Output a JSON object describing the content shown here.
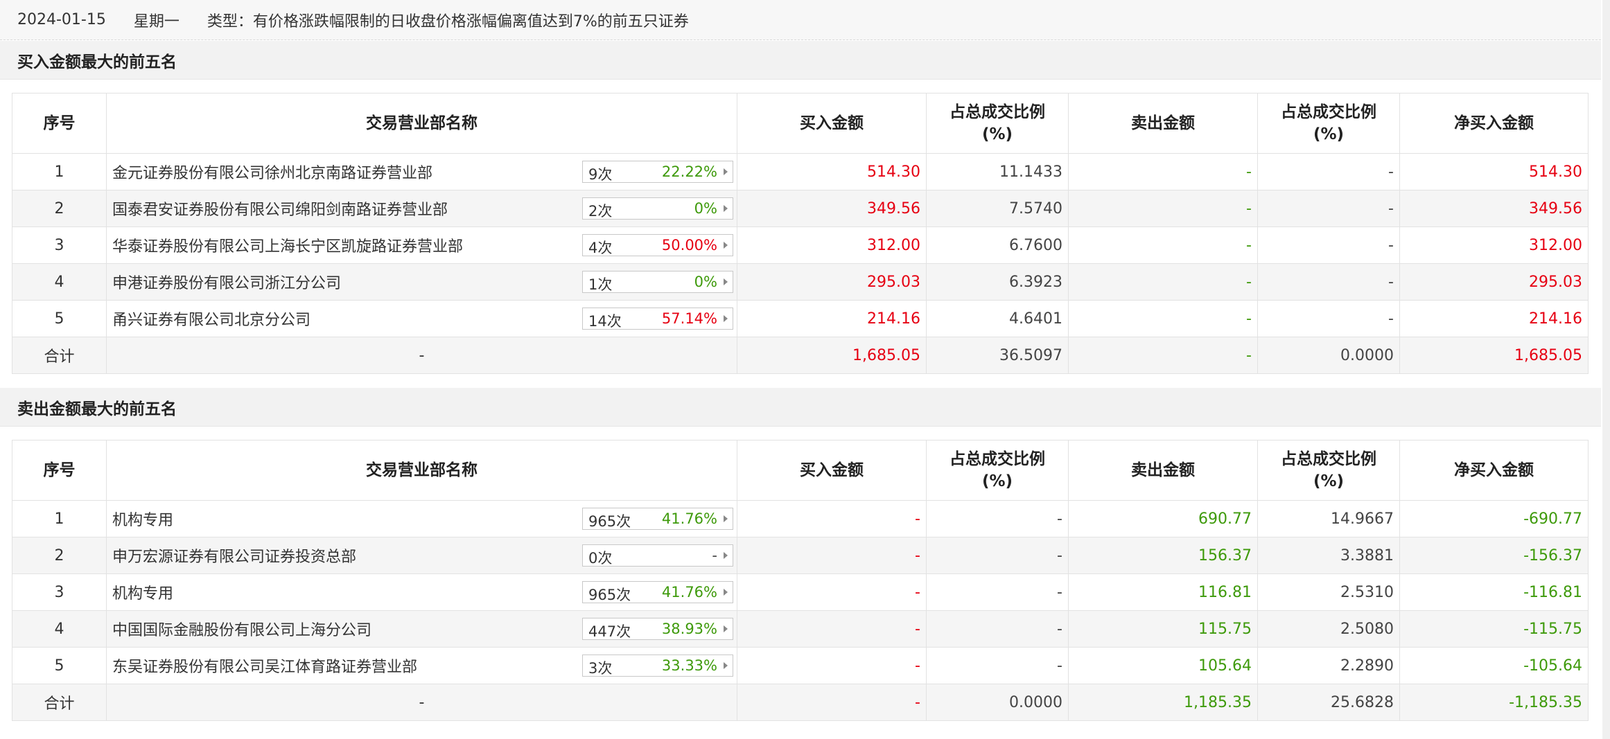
{
  "header": {
    "date": "2024-01-15",
    "weekday": "星期一",
    "type": "类型：有价格涨跌幅限制的日收盘价格涨幅偏离值达到7%的前五只证券"
  },
  "columns": {
    "seq": "序号",
    "name": "交易营业部名称",
    "buy": "买入金额",
    "ratio1_a": "占总成交比例",
    "ratio1_b": "(%)",
    "sell": "卖出金额",
    "ratio2_a": "占总成交比例",
    "ratio2_b": "(%)",
    "net": "净买入金额"
  },
  "colors": {
    "up": "#e60012",
    "down": "#3e9a0b"
  },
  "buy_table": {
    "title": "买入金额最大的前五名",
    "rows": [
      {
        "seq": "1",
        "name": "金元证券股份有限公司徐州北京南路证券营业部",
        "count": "9次",
        "pct": "22.22%",
        "pct_color": "green",
        "buy": "514.30",
        "ratio1": "11.1433",
        "sell": "-",
        "ratio2": "-",
        "net": "514.30"
      },
      {
        "seq": "2",
        "name": "国泰君安证券股份有限公司绵阳剑南路证券营业部",
        "count": "2次",
        "pct": "0%",
        "pct_color": "green",
        "buy": "349.56",
        "ratio1": "7.5740",
        "sell": "-",
        "ratio2": "-",
        "net": "349.56"
      },
      {
        "seq": "3",
        "name": "华泰证券股份有限公司上海长宁区凯旋路证券营业部",
        "count": "4次",
        "pct": "50.00%",
        "pct_color": "red",
        "buy": "312.00",
        "ratio1": "6.7600",
        "sell": "-",
        "ratio2": "-",
        "net": "312.00"
      },
      {
        "seq": "4",
        "name": "申港证券股份有限公司浙江分公司",
        "count": "1次",
        "pct": "0%",
        "pct_color": "green",
        "buy": "295.03",
        "ratio1": "6.3923",
        "sell": "-",
        "ratio2": "-",
        "net": "295.03"
      },
      {
        "seq": "5",
        "name": "甬兴证券有限公司北京分公司",
        "count": "14次",
        "pct": "57.14%",
        "pct_color": "red",
        "buy": "214.16",
        "ratio1": "4.6401",
        "sell": "-",
        "ratio2": "-",
        "net": "214.16"
      }
    ],
    "total": {
      "label": "合计",
      "name": "-",
      "buy": "1,685.05",
      "ratio1": "36.5097",
      "sell": "-",
      "ratio2": "0.0000",
      "net": "1,685.05"
    }
  },
  "sell_table": {
    "title": "卖出金额最大的前五名",
    "rows": [
      {
        "seq": "1",
        "name": "机构专用",
        "count": "965次",
        "pct": "41.76%",
        "pct_color": "green",
        "buy": "-",
        "ratio1": "-",
        "sell": "690.77",
        "ratio2": "14.9667",
        "net": "-690.77"
      },
      {
        "seq": "2",
        "name": "申万宏源证券有限公司证券投资总部",
        "count": "0次",
        "pct": "-",
        "pct_color": "gray",
        "buy": "-",
        "ratio1": "-",
        "sell": "156.37",
        "ratio2": "3.3881",
        "net": "-156.37"
      },
      {
        "seq": "3",
        "name": "机构专用",
        "count": "965次",
        "pct": "41.76%",
        "pct_color": "green",
        "buy": "-",
        "ratio1": "-",
        "sell": "116.81",
        "ratio2": "2.5310",
        "net": "-116.81"
      },
      {
        "seq": "4",
        "name": "中国国际金融股份有限公司上海分公司",
        "count": "447次",
        "pct": "38.93%",
        "pct_color": "green",
        "buy": "-",
        "ratio1": "-",
        "sell": "115.75",
        "ratio2": "2.5080",
        "net": "-115.75"
      },
      {
        "seq": "5",
        "name": "东吴证券股份有限公司吴江体育路证券营业部",
        "count": "3次",
        "pct": "33.33%",
        "pct_color": "green",
        "buy": "-",
        "ratio1": "-",
        "sell": "105.64",
        "ratio2": "2.2890",
        "net": "-105.64"
      }
    ],
    "total": {
      "label": "合计",
      "name": "-",
      "buy": "-",
      "ratio1": "0.0000",
      "sell": "1,185.35",
      "ratio2": "25.6828",
      "net": "-1,185.35"
    }
  }
}
